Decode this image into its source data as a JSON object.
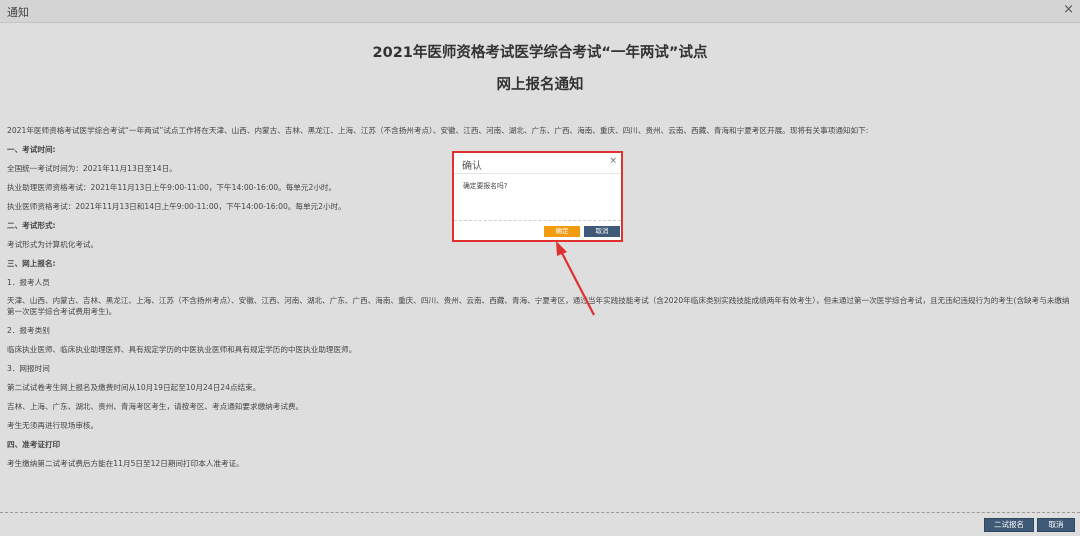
{
  "window": {
    "title": "通知",
    "close_glyph": "×"
  },
  "notice": {
    "title": "2021年医师资格考试医学综合考试“一年两试”试点",
    "subtitle": "网上报名通知",
    "paragraphs": [
      "2021年医师资格考试医学综合考试“一年两试”试点工作将在天津、山西、内蒙古、吉林、黑龙江、上海、江苏（不含扬州考点）、安徽、江西、河南、湖北、广东、广西、海南、重庆、四川、贵州、云南、西藏、青海和宁夏考区开展。现将有关事项通知如下:",
      "一、考试时间:",
      "全国统一考试时间为：2021年11月13日至14日。",
      "执业助理医师资格考试：2021年11月13日上午9:00-11:00，下午14:00-16:00。每单元2小时。",
      "执业医师资格考试：2021年11月13日和14日上午9:00-11:00，下午14:00-16:00。每单元2小时。",
      "二、考试形式:",
      "考试形式为计算机化考试。",
      "三、网上报名:",
      "1．报考人员",
      "天津、山西、内蒙古、吉林、黑龙江、上海、江苏（不含扬州考点）、安徽、江西、河南、湖北、广东、广西、海南、重庆、四川、贵州、云南、西藏、青海、宁夏考区，通过当年实践技能考试（含2020年临床类别实践技能成绩两年有效考生），但未通过第一次医学综合考试，且无违纪违规行为的考生(含缺考与未缴纳第一次医学综合考试费用考生)。",
      "2．报考类别",
      "临床执业医师、临床执业助理医师、具有规定学历的中医执业医师和具有规定学历的中医执业助理医师。",
      "3．网报时间",
      "第二试试卷考生网上报名及缴费时间从10月19日起至10月24日24点结束。",
      "吉林、上海、广东、湖北、贵州、青海考区考生，请按考区、考点通知要求缴纳考试费。",
      "考生无须再进行现场审核。",
      "四、准考证打印",
      "考生缴纳第二试考试费后方能在11月5日至12日期间打印本人准考证。"
    ]
  },
  "footer": {
    "second_exam_button": "二试报名",
    "cancel_button": "取消"
  },
  "dialog": {
    "title": "确认",
    "close_glyph": "×",
    "message": "确定要报名吗?",
    "ok_button": "确定",
    "cancel_button": "取消"
  },
  "colors": {
    "annotation": "#e03030",
    "primary_button": "#3f5a76",
    "ok_button": "#f39c12"
  }
}
